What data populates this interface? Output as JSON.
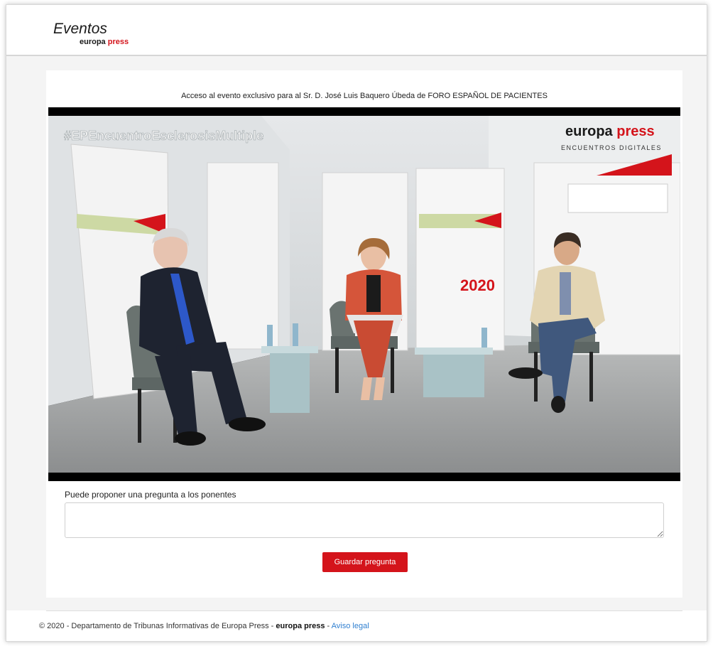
{
  "header": {
    "title": "Eventos",
    "brand_black": "europa",
    "brand_red": "press"
  },
  "main": {
    "access_text": "Acceso al evento exclusivo para al Sr. D. José Luis Baquero Úbeda de FORO ESPAÑOL DE PACIENTES",
    "video": {
      "hashtag": "#EPEncuentroEsclerosisMultiple",
      "logo_black": "europa",
      "logo_red": "press",
      "logo_sub": "ENCUENTROS DIGITALES",
      "year": "2020"
    },
    "question_label": "Puede proponer una pregunta a los ponentes",
    "question_value": "",
    "save_button_label": "Guardar pregunta"
  },
  "footer": {
    "copyright": "© 2020 - Departamento de Tribunas Informativas de Europa Press - ",
    "brand_black": "europa",
    "brand_red": "press",
    "separator": " - ",
    "legal_link": "Aviso legal"
  },
  "colors": {
    "brand_red": "#d4141b",
    "link_blue": "#2f7fd0"
  }
}
